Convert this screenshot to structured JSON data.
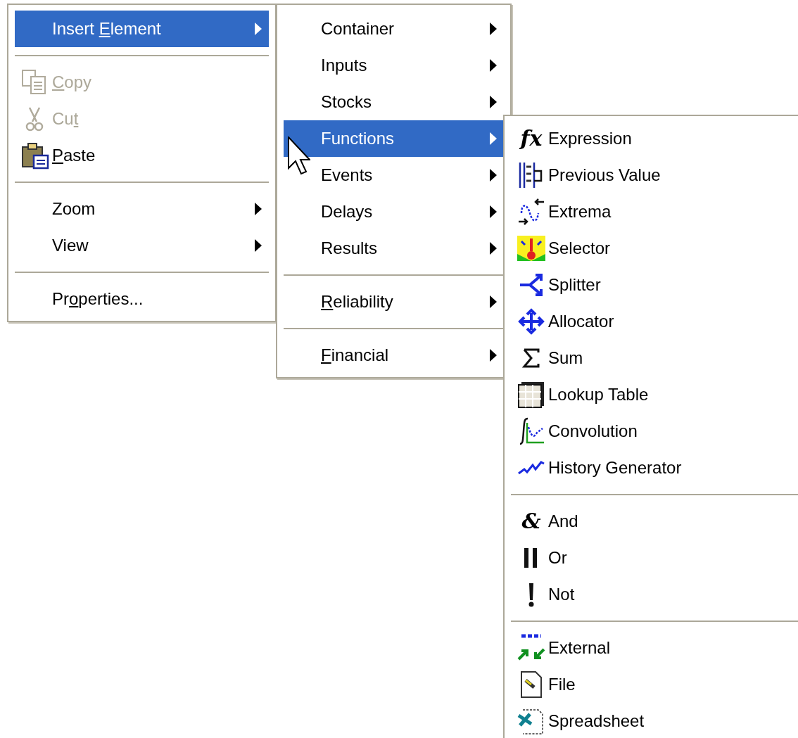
{
  "menus": [
    {
      "groups": [
        [
          {
            "label": [
              {
                "text": "Insert "
              },
              {
                "text": "E",
                "underlined": true
              },
              {
                "text": "lement"
              }
            ],
            "selected": true,
            "disabled": false,
            "submenu": true
          }
        ],
        [
          {
            "label": [
              {
                "text": "C",
                "underlined": true
              },
              {
                "text": "opy"
              }
            ],
            "selected": false,
            "disabled": true,
            "submenu": false
          },
          {
            "label": [
              {
                "text": "Cu"
              },
              {
                "text": "t",
                "underlined": true
              }
            ],
            "selected": false,
            "disabled": true,
            "submenu": false
          },
          {
            "label": [
              {
                "text": "P",
                "underlined": true
              },
              {
                "text": "aste"
              }
            ],
            "selected": false,
            "disabled": false,
            "submenu": false
          }
        ],
        [
          {
            "label": [
              {
                "text": "Zoom"
              }
            ],
            "selected": false,
            "disabled": false,
            "submenu": true
          },
          {
            "label": [
              {
                "text": "View"
              }
            ],
            "selected": false,
            "disabled": false,
            "submenu": true
          }
        ],
        [
          {
            "label": [
              {
                "text": "Pr"
              },
              {
                "text": "o",
                "underlined": true
              },
              {
                "text": "perties..."
              }
            ],
            "selected": false,
            "disabled": false,
            "submenu": false
          }
        ]
      ]
    },
    {
      "groups": [
        [
          {
            "label": [
              {
                "text": "Container"
              }
            ],
            "selected": false,
            "disabled": false,
            "submenu": true
          },
          {
            "label": [
              {
                "text": "Inputs"
              }
            ],
            "selected": false,
            "disabled": false,
            "submenu": true
          },
          {
            "label": [
              {
                "text": "Stocks"
              }
            ],
            "selected": false,
            "disabled": false,
            "submenu": true
          },
          {
            "label": [
              {
                "text": "Functions"
              }
            ],
            "selected": true,
            "disabled": false,
            "submenu": true
          },
          {
            "label": [
              {
                "text": "Events"
              }
            ],
            "selected": false,
            "disabled": false,
            "submenu": true
          },
          {
            "label": [
              {
                "text": "Delays"
              }
            ],
            "selected": false,
            "disabled": false,
            "submenu": true
          },
          {
            "label": [
              {
                "text": "Results"
              }
            ],
            "selected": false,
            "disabled": false,
            "submenu": true
          }
        ],
        [
          {
            "label": [
              {
                "text": "R",
                "underlined": true
              },
              {
                "text": "eliability"
              }
            ],
            "selected": false,
            "disabled": false,
            "submenu": true
          }
        ],
        [
          {
            "label": [
              {
                "text": "F",
                "underlined": true
              },
              {
                "text": "inancial"
              }
            ],
            "selected": false,
            "disabled": false,
            "submenu": true
          }
        ]
      ]
    },
    {
      "groups": [
        [
          {
            "label": [
              {
                "text": "Expression"
              }
            ],
            "glyph": "fx",
            "selected": false,
            "disabled": false,
            "submenu": false
          },
          {
            "label": [
              {
                "text": "Previous Value"
              }
            ],
            "selected": false,
            "disabled": false,
            "submenu": false
          },
          {
            "label": [
              {
                "text": "Extrema"
              }
            ],
            "selected": false,
            "disabled": false,
            "submenu": false
          },
          {
            "label": [
              {
                "text": "Selector"
              }
            ],
            "selected": false,
            "disabled": false,
            "submenu": false
          },
          {
            "label": [
              {
                "text": "Splitter"
              }
            ],
            "selected": false,
            "disabled": false,
            "submenu": false
          },
          {
            "label": [
              {
                "text": "Allocator"
              }
            ],
            "selected": false,
            "disabled": false,
            "submenu": false
          },
          {
            "label": [
              {
                "text": "Sum"
              }
            ],
            "selected": false,
            "disabled": false,
            "submenu": false
          },
          {
            "label": [
              {
                "text": "Lookup Table"
              }
            ],
            "selected": false,
            "disabled": false,
            "submenu": false
          },
          {
            "label": [
              {
                "text": "Convolution"
              }
            ],
            "selected": false,
            "disabled": false,
            "submenu": false
          },
          {
            "label": [
              {
                "text": "History Generator"
              }
            ],
            "selected": false,
            "disabled": false,
            "submenu": false
          }
        ],
        [
          {
            "label": [
              {
                "text": "And"
              }
            ],
            "glyph": "&",
            "selected": false,
            "disabled": false,
            "submenu": false
          },
          {
            "label": [
              {
                "text": "Or"
              }
            ],
            "selected": false,
            "disabled": false,
            "submenu": false
          },
          {
            "label": [
              {
                "text": "Not"
              }
            ],
            "selected": false,
            "disabled": false,
            "submenu": false
          }
        ],
        [
          {
            "label": [
              {
                "text": "External"
              }
            ],
            "selected": false,
            "disabled": false,
            "submenu": false
          },
          {
            "label": [
              {
                "text": "File"
              }
            ],
            "selected": false,
            "disabled": false,
            "submenu": false
          },
          {
            "label": [
              {
                "text": "Spreadsheet"
              }
            ],
            "selected": false,
            "disabled": false,
            "submenu": false
          }
        ]
      ]
    }
  ]
}
